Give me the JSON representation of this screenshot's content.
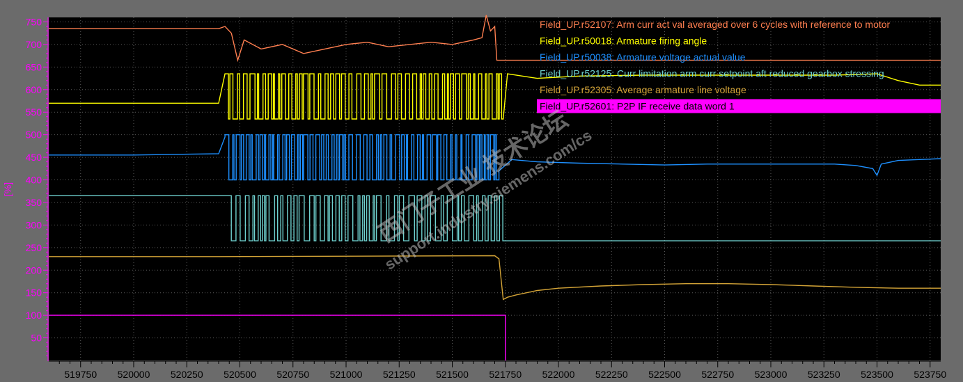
{
  "chart_data": {
    "type": "line",
    "ylabel": "[%]",
    "xlim": [
      519600,
      523800
    ],
    "ylim": [
      0,
      760
    ],
    "y_ticks": [
      50,
      100,
      150,
      200,
      250,
      300,
      350,
      400,
      450,
      500,
      550,
      600,
      650,
      700,
      750
    ],
    "x_ticks": [
      519750,
      520000,
      520250,
      520500,
      520750,
      521000,
      521250,
      521500,
      521750,
      522000,
      522250,
      522500,
      522750,
      523000,
      523250,
      523500,
      523750
    ],
    "grid": true,
    "legend_position": "top-right",
    "series": [
      {
        "name": "Field_UP.r52107: Arm curr act val averaged over 6 cycles with reference to motor",
        "color": "#ff7f50",
        "x": [
          519600,
          520400,
          520430,
          520460,
          520490,
          520520,
          520600,
          520700,
          520800,
          520900,
          521000,
          521100,
          521200,
          521300,
          521400,
          521500,
          521600,
          521640,
          521660,
          521680,
          521700,
          521710,
          523800
        ],
        "y": [
          735,
          735,
          740,
          725,
          665,
          710,
          690,
          700,
          680,
          690,
          700,
          705,
          695,
          700,
          705,
          700,
          710,
          715,
          765,
          730,
          740,
          665,
          665
        ]
      },
      {
        "name": "Field_UP.r50018: Armature firing angle",
        "color": "#ffff00",
        "x": [
          519600,
          520000,
          520400,
          520430,
          521740,
          521760,
          521900,
          522100,
          522400,
          522700,
          523000,
          523300,
          523500,
          523600,
          523700,
          523800
        ],
        "y": [
          570,
          570,
          570,
          635,
          535,
          635,
          625,
          630,
          632,
          632,
          632,
          632,
          635,
          620,
          610,
          610
        ],
        "burst": {
          "from": 520430,
          "to": 521740,
          "low": 535,
          "high": 635,
          "step": 13
        }
      },
      {
        "name": "Field_UP.r50038: Armature voltage actual value",
        "color": "#1e90ff",
        "x": [
          519600,
          520000,
          520400,
          520430,
          521720,
          521780,
          521900,
          522100,
          522300,
          522500,
          522700,
          522900,
          523100,
          523300,
          523400,
          523480,
          523500,
          523520,
          523600,
          523700,
          523800
        ],
        "y": [
          455,
          455,
          458,
          495,
          420,
          445,
          440,
          437,
          435,
          433,
          435,
          435,
          435,
          435,
          432,
          425,
          410,
          435,
          443,
          445,
          447
        ],
        "burst": {
          "from": 520430,
          "to": 521720,
          "low": 400,
          "high": 500,
          "step": 11
        }
      },
      {
        "name": "Field_UP.r52125: Curr limitation arm curr setpoint aft reduced gearbox stressing",
        "color": "#6fd1cf",
        "x": [
          519600,
          520450,
          520450,
          521750,
          521750,
          523800
        ],
        "y": [
          365,
          365,
          365,
          265,
          265,
          265
        ],
        "burst": {
          "from": 520450,
          "to": 521750,
          "low": 265,
          "high": 365,
          "step": 15
        }
      },
      {
        "name": "Field_UP.r52305: Average armature line voltage",
        "color": "#d4a437",
        "x": [
          519600,
          520400,
          521700,
          521720,
          521740,
          521760,
          521800,
          521900,
          522000,
          522200,
          522400,
          522600,
          522800,
          523000,
          523200,
          523400,
          523600,
          523800
        ],
        "y": [
          230,
          230,
          232,
          225,
          135,
          140,
          145,
          155,
          160,
          165,
          168,
          170,
          170,
          168,
          165,
          162,
          160,
          160
        ]
      },
      {
        "name": "Field_UP.r52601: P2P IF receive data word 1",
        "color": "#ff00ff",
        "x": [
          519600,
          521750,
          521750
        ],
        "y": [
          100,
          100,
          0
        ]
      }
    ]
  },
  "watermark": {
    "cn": "西门子工业 技术论坛",
    "url": "support.industry.siemens.com/cs"
  }
}
